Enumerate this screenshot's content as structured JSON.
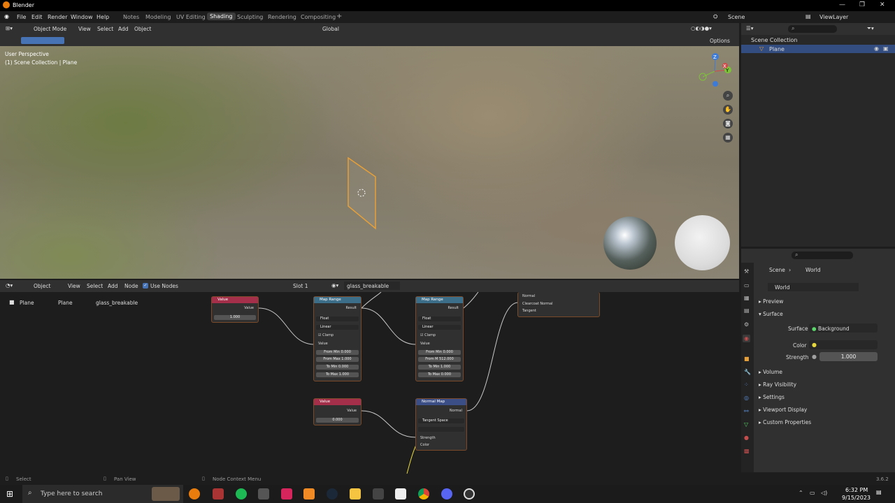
{
  "app": {
    "title": "Blender",
    "version": "3.6.2"
  },
  "menu": [
    "File",
    "Edit",
    "Render",
    "Window",
    "Help"
  ],
  "workspaces": [
    "Notes",
    "Modeling",
    "UV Editing",
    "Shading",
    "Sculpting",
    "Rendering",
    "Compositing"
  ],
  "active_workspace": "Shading",
  "scene": {
    "name": "Scene",
    "view_layer": "ViewLayer"
  },
  "viewport": {
    "mode": "Object Mode",
    "menus": [
      "View",
      "Select",
      "Add",
      "Object"
    ],
    "transform": "Global",
    "options": "Options",
    "overlay_line1": "User Perspective",
    "overlay_line2": "(1) Scene Collection | Plane",
    "axes": [
      "Z",
      "Y",
      "X"
    ]
  },
  "outliner": {
    "collection": "Scene Collection",
    "items": [
      {
        "label": "Plane"
      }
    ]
  },
  "node_editor": {
    "object_type": "Object",
    "menus": [
      "View",
      "Select",
      "Add",
      "Node"
    ],
    "use_nodes": "Use Nodes",
    "slot": "Slot 1",
    "material": "glass_breakable",
    "breadcrumb": [
      "Plane",
      "Plane",
      "glass_breakable"
    ],
    "nodes": {
      "value1": {
        "title": "Value",
        "out": "Value",
        "val": "1.000"
      },
      "value2": {
        "title": "Value",
        "out": "Value",
        "val": "0.000"
      },
      "map1": {
        "title": "Map Range",
        "out": "Result",
        "type": "Float",
        "interp": "Linear",
        "clamp": "Clamp",
        "in": "Value",
        "fields": [
          [
            "From Min",
            "0.000"
          ],
          [
            "From Max",
            "1.000"
          ],
          [
            "To Min",
            "0.000"
          ],
          [
            "To Max",
            "1.000"
          ]
        ]
      },
      "map2": {
        "title": "Map Range",
        "out": "Result",
        "type": "Float",
        "interp": "Linear",
        "clamp": "Clamp",
        "in": "Value",
        "fields": [
          [
            "From Min",
            "0.000"
          ],
          [
            "From M",
            "512.000"
          ],
          [
            "To Min",
            "1.000"
          ],
          [
            "To Max",
            "0.000"
          ]
        ]
      },
      "normalmap": {
        "title": "Normal Map",
        "out": "Normal",
        "space": "Tangent Space",
        "strength": "Strength",
        "color": "Color"
      },
      "bsdf": {
        "labels": [
          "Normal",
          "Clearcoat Normal",
          "Tangent"
        ]
      }
    }
  },
  "properties": {
    "breadcrumb": [
      "Scene",
      "World"
    ],
    "world": "World",
    "panels": {
      "preview": "Preview",
      "surface": "Surface",
      "volume": "Volume",
      "ray": "Ray Visibility",
      "settings": "Settings",
      "viewport": "Viewport Display",
      "custom": "Custom Properties"
    },
    "surface_label": "Surface",
    "surface_value": "Background",
    "color_label": "Color",
    "strength_label": "Strength",
    "strength_value": "1.000"
  },
  "status": {
    "select": "Select",
    "pan": "Pan View",
    "context": "Node Context Menu"
  },
  "taskbar": {
    "search": "Type here to search",
    "time": "6:32 PM",
    "date": "9/15/2023"
  },
  "colors": {
    "accent": "#4772b3",
    "orange": "#e7a038",
    "node_value": "#a32f4a",
    "node_vector": "#3b4f86",
    "node_converter": "#3d6e89"
  }
}
